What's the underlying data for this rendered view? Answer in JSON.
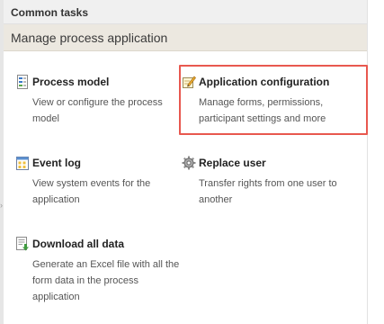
{
  "panel": {
    "title": "Common tasks",
    "subtitle": "Manage process application"
  },
  "tasks": [
    {
      "title": "Process model",
      "description": "View or configure the process model",
      "icon": "process-model-icon"
    },
    {
      "title": "Application configuration",
      "description": "Manage forms, permissions, participant settings and more",
      "icon": "pencil-note-icon"
    },
    {
      "title": "Event log",
      "description": "View system events for the application",
      "icon": "event-log-icon"
    },
    {
      "title": "Replace user",
      "description": "Transfer rights from one user to another",
      "icon": "gear-icon"
    },
    {
      "title": "Download all data",
      "description": "Generate an Excel file with all the form data in the process application",
      "icon": "download-document-icon"
    }
  ],
  "colors": {
    "highlight": "#e8584f",
    "subheader_bg": "#ece8e0",
    "header_bg": "#f0f0f0"
  }
}
